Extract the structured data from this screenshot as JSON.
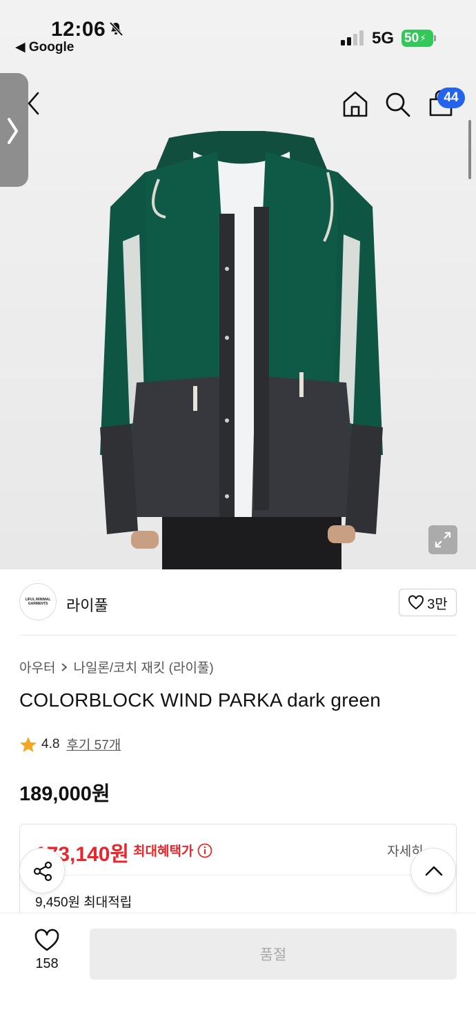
{
  "status_bar": {
    "time": "12:06",
    "back_app": "◀ Google",
    "network": "5G",
    "battery": "50",
    "icons": [
      "bell-off-icon",
      "signal-icon",
      "battery-icon"
    ]
  },
  "header": {
    "icons": [
      "back-arrow-icon",
      "home-icon",
      "search-icon",
      "shopping-bag-icon"
    ],
    "cart_count": "44"
  },
  "brand": {
    "logo_text": "LIFUL MINIMAL GARMENTS",
    "name": "라이풀",
    "like_count": "3만"
  },
  "product": {
    "breadcrumb": [
      "아우터",
      "나일론/코치 재킷 (라이풀)"
    ],
    "title": "COLORBLOCK WIND PARKA dark green",
    "rating": "4.8",
    "review_label": "후기 57개",
    "original_price": "189,000원"
  },
  "benefit": {
    "price": "173,140원",
    "label": "최대혜택가",
    "detail_link": "자세히",
    "points": "9,450원 최대적립"
  },
  "bottom_bar": {
    "wish_count": "158",
    "soldout_label": "품절"
  },
  "colors": {
    "accent_blue": "#2463eb",
    "sale_red": "#e8262b",
    "jacket_green": "#0f5a46",
    "jacket_charcoal": "#36383d"
  }
}
